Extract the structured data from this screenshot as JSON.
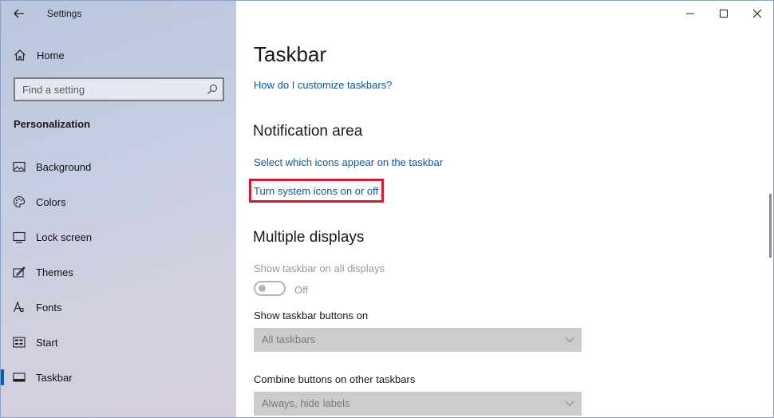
{
  "window": {
    "app_title": "Settings",
    "accent_color": "#0063b1",
    "link_color": "#0a5aa3",
    "highlight_color": "#d8182b"
  },
  "sidebar": {
    "home_label": "Home",
    "search_placeholder": "Find a setting",
    "section_title": "Personalization",
    "items": [
      {
        "label": "Background",
        "icon": "picture-icon"
      },
      {
        "label": "Colors",
        "icon": "palette-icon"
      },
      {
        "label": "Lock screen",
        "icon": "lock-screen-icon"
      },
      {
        "label": "Themes",
        "icon": "themes-icon"
      },
      {
        "label": "Fonts",
        "icon": "fonts-icon"
      },
      {
        "label": "Start",
        "icon": "start-icon"
      },
      {
        "label": "Taskbar",
        "icon": "taskbar-icon",
        "active": true
      }
    ]
  },
  "main": {
    "title": "Taskbar",
    "help_link": "How do I customize taskbars?",
    "notification_area": {
      "heading": "Notification area",
      "select_icons_link": "Select which icons appear on the taskbar",
      "system_icons_link": "Turn system icons on or off"
    },
    "multiple_displays": {
      "heading": "Multiple displays",
      "show_all_label": "Show taskbar on all displays",
      "show_all_state": "Off",
      "show_buttons_label": "Show taskbar buttons on",
      "show_buttons_value": "All taskbars",
      "combine_label": "Combine buttons on other taskbars",
      "combine_value": "Always, hide labels"
    }
  }
}
